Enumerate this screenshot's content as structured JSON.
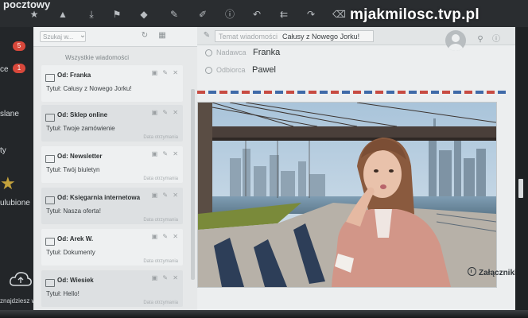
{
  "app": {
    "title": "pocztowy"
  },
  "watermark": "mjakmilosc.tvp.pl",
  "toolbar": {
    "icons": [
      "star-icon",
      "bell-icon",
      "download-icon",
      "flag-icon",
      "tag-icon",
      "pen-icon",
      "pencil-icon",
      "info-icon",
      "reply-icon",
      "reply-all-icon",
      "forward-icon",
      "trash-icon"
    ]
  },
  "sidebar": {
    "items": [
      {
        "label": "",
        "badge": "5"
      },
      {
        "label": "ce",
        "badge": "1"
      },
      {
        "label": "slane",
        "badge": ""
      },
      {
        "label": "ty",
        "badge": ""
      }
    ],
    "favorites_label": "ulubione",
    "cloud_label": "znajdziesz w chmurze"
  },
  "list": {
    "search_placeholder": "Szukaj w...",
    "all_label": "Wszystkie wiadomości",
    "messages": [
      {
        "from": "Od: Franka",
        "subject": "Tytuł: Całusy z Nowego Jorku!",
        "date": ""
      },
      {
        "from": "Od: Sklep online",
        "subject": "Tytuł: Twoje zamówienie",
        "date": "Data otrzymania"
      },
      {
        "from": "Od: Newsletter",
        "subject": "Tytuł: Twój biuletyn",
        "date": "Data otrzymania"
      },
      {
        "from": "Od: Księgarnia internetowa",
        "subject": "Tytuł: Nasza oferta!",
        "date": "Data otrzymania"
      },
      {
        "from": "Od: Arek W.",
        "subject": "Tytuł: Dokumenty",
        "date": "Data otrzymania"
      },
      {
        "from": "Od: Wiesiek",
        "subject": "Tytuł: Hello!",
        "date": "Data otrzymania"
      }
    ]
  },
  "reader": {
    "subject_label": "Temat wiadomości",
    "subject": "Całusy z Nowego Jorku!",
    "sender_label": "Nadawca",
    "sender": "Franka",
    "recipient_label": "Odbiorca",
    "recipient": "Pawel",
    "attachments_label": "Załączniki"
  },
  "colors": {
    "airmail_red": "#c74b42",
    "airmail_blue": "#3f6aa8",
    "badge": "#d9483b"
  }
}
